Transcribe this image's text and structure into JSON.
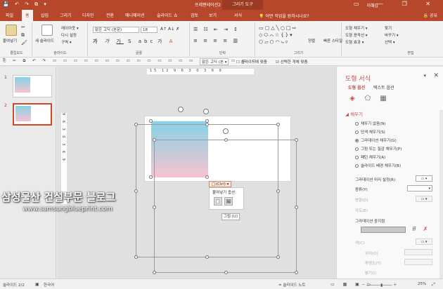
{
  "window": {
    "title": "프레젠테이션2 - PowerPoint",
    "tool_tab": "그리기 도구",
    "user": "이혜갑",
    "qat": "💾 ↶ ↷ ⧉ ▾",
    "controls": "▭ — ❐ ✕"
  },
  "tabs": [
    {
      "label": "파일"
    },
    {
      "label": "홈"
    },
    {
      "label": "삽입"
    },
    {
      "label": "그리기"
    },
    {
      "label": "디자인"
    },
    {
      "label": "전환"
    },
    {
      "label": "애니메이션"
    },
    {
      "label": "슬라이드 쇼"
    },
    {
      "label": "검토"
    },
    {
      "label": "보기"
    },
    {
      "label": "서식"
    }
  ],
  "tell_me": "💡 어떤 작업을 원하시나요?",
  "share": "🔒 공유",
  "ribbon": {
    "clipboard": {
      "paste": "붙여넣기",
      "label": "클립보드"
    },
    "slides": {
      "new_slide": "새 슬라이드",
      "layout": "레이아웃 ▾",
      "reset": "다시 설정",
      "section": "구역 ▾",
      "label": "슬라이드"
    },
    "font": {
      "name": "맑은 고딕 (본문)",
      "size": "18",
      "label": "글꼴"
    },
    "paragraph": {
      "label": "단락"
    },
    "drawing": {
      "arrange": "정렬",
      "quick_styles": "빠른 스타일",
      "fill": "도형 채우기 ▾",
      "outline": "도형 윤곽선 ▾",
      "effects": "도형 효과 ▾",
      "label": "그리기"
    },
    "editing": {
      "find": "찾기",
      "replace": "바꾸기 ▾",
      "select": "선택 ▾",
      "label": "편집"
    }
  },
  "toolbar2": {
    "font": "맑은 고딕 (본 ▾",
    "fit_slide": "슬라이드에 맞춤",
    "fit_selected": "선택한 개체 맞춤"
  },
  "slides": [
    {
      "number": "1"
    },
    {
      "number": "2"
    }
  ],
  "editor": {
    "ruler": "15 12 9 6 3 0 3 6 9",
    "vruler": "9 6 3 0 3 6 9",
    "paste_ctrl": "📋(Ctrl) ▾",
    "paste_options_label": "붙여넣기 옵션:",
    "paste_icons": [
      "📋",
      "🖼"
    ],
    "picture_tooltip": "그림 (U)"
  },
  "watermark": {
    "title": "삼성물산 건설부문 블로그",
    "url": "www.samsungblueprint.com"
  },
  "pane": {
    "title": "도형 서식",
    "tab_shape": "도형 옵션",
    "tab_text": "텍스트 옵션",
    "section_fill": "◢ 채우기",
    "fill_options": [
      {
        "label": "채우기 없음(N)",
        "selected": false
      },
      {
        "label": "단색 채우기(S)",
        "selected": false
      },
      {
        "label": "그라데이션 채우기(G)",
        "selected": true
      },
      {
        "label": "그림 또는 질감 채우기(P)",
        "selected": false
      },
      {
        "label": "패턴 채우기(A)",
        "selected": false
      },
      {
        "label": "슬라이드 배경 채우기(B)",
        "selected": false
      }
    ],
    "preset_gradient": "그라데이션 미리 설정(R)",
    "type": "종류(Y)",
    "direction": "방향(D)",
    "angle": "각도(E)",
    "gradient_stops": "그라데이션 중지점",
    "color": "색(C)",
    "position": "위치(O)",
    "transparency": "투명도(T)",
    "brightness": "밝기(I)"
  },
  "status": {
    "slide": "슬라이드 2/2",
    "language": "한국어",
    "notes": "≐ 슬라이드 노트",
    "zoom": "25%"
  }
}
